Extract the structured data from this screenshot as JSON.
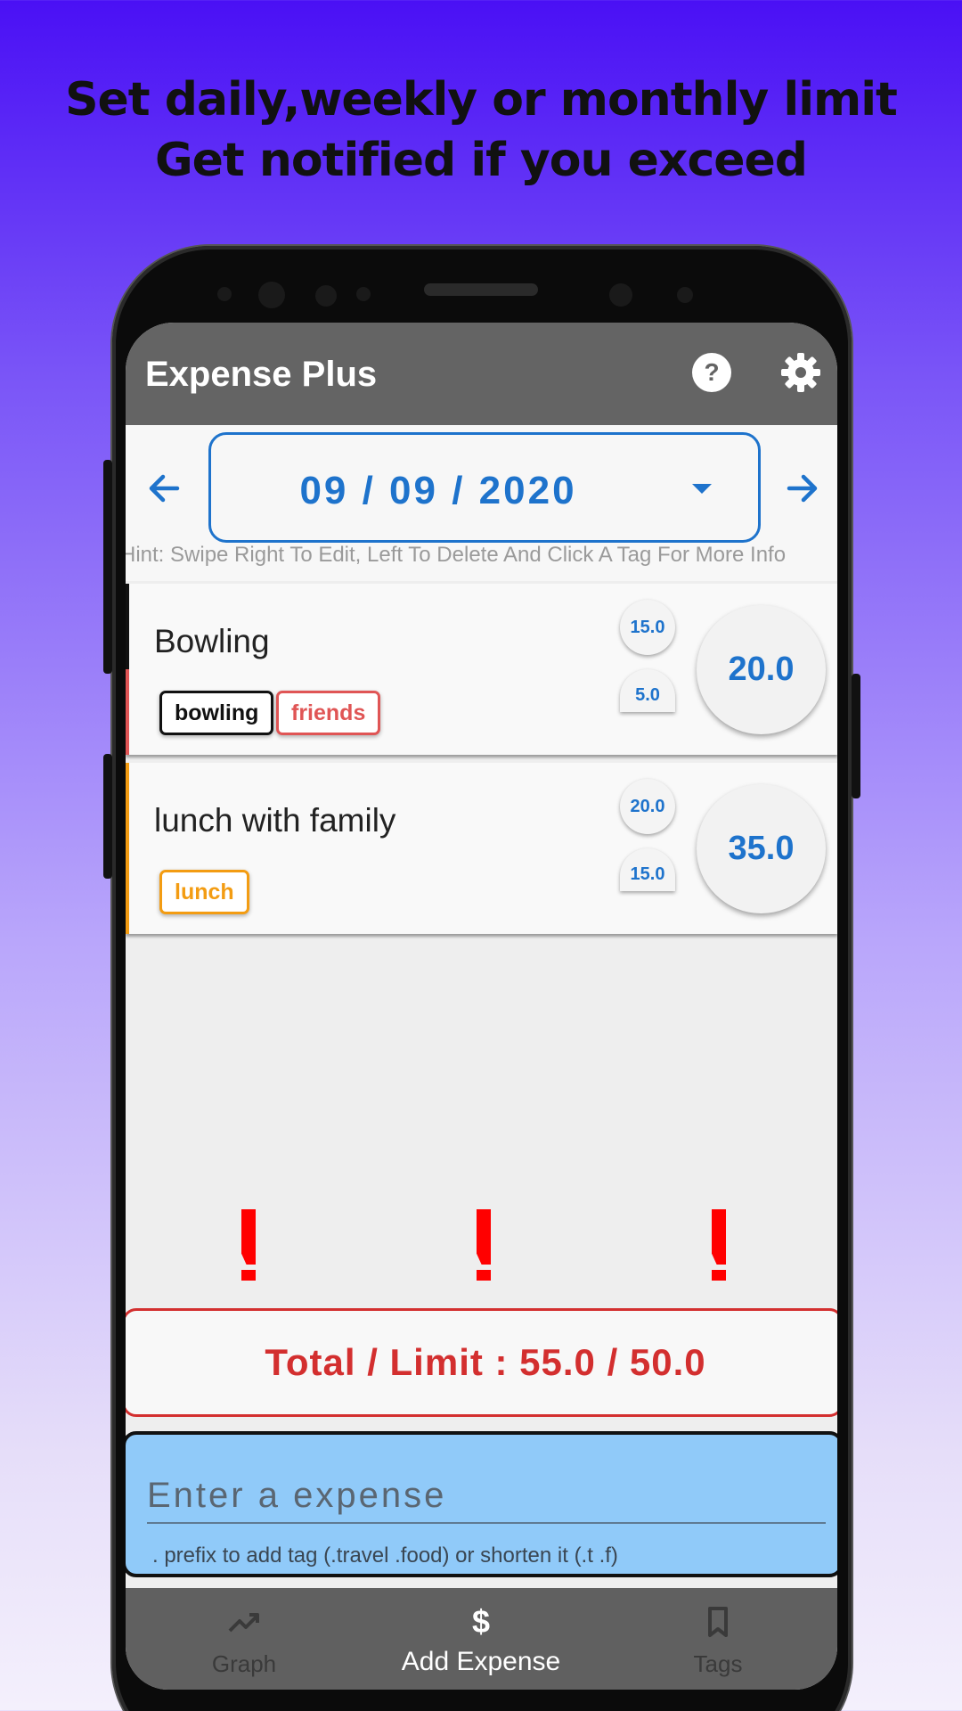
{
  "promo": {
    "line1": "Set daily,weekly or monthly limit",
    "line2": "Get notified if you exceed"
  },
  "appbar": {
    "title": "Expense Plus",
    "help_icon": "help-circle-icon",
    "settings_icon": "gear-icon"
  },
  "date_picker": {
    "value": "09 / 09 / 2020",
    "prev_icon": "arrow-left-icon",
    "next_icon": "arrow-right-icon",
    "dropdown_icon": "caret-down-icon"
  },
  "hint": "Hint: Swipe Right To Edit, Left To Delete And Click A Tag For More Info",
  "expenses": [
    {
      "title": "Bowling",
      "tags": [
        {
          "label": "bowling",
          "color": "#111111"
        },
        {
          "label": "friends",
          "color": "#e05555"
        }
      ],
      "amounts": [
        "15.0",
        "5.0"
      ],
      "total": "20.0"
    },
    {
      "title": "lunch with family",
      "tags": [
        {
          "label": "lunch",
          "color": "#f39c12"
        }
      ],
      "amounts": [
        "20.0",
        "15.0"
      ],
      "total": "35.0"
    }
  ],
  "warnings": [
    "!",
    "!",
    "!"
  ],
  "summary": {
    "text": "Total / Limit : 55.0 / 50.0",
    "color": "#d32f2f"
  },
  "input": {
    "placeholder": "Enter a expense",
    "helper": ". prefix to add tag (.travel .food) or shorten it (.t .f)"
  },
  "nav": {
    "items": [
      {
        "label": "Graph",
        "icon": "trending-up-icon"
      },
      {
        "label": "Add Expense",
        "icon": "dollar-icon"
      },
      {
        "label": "Tags",
        "icon": "bookmark-icon"
      }
    ],
    "active_index": 1
  }
}
